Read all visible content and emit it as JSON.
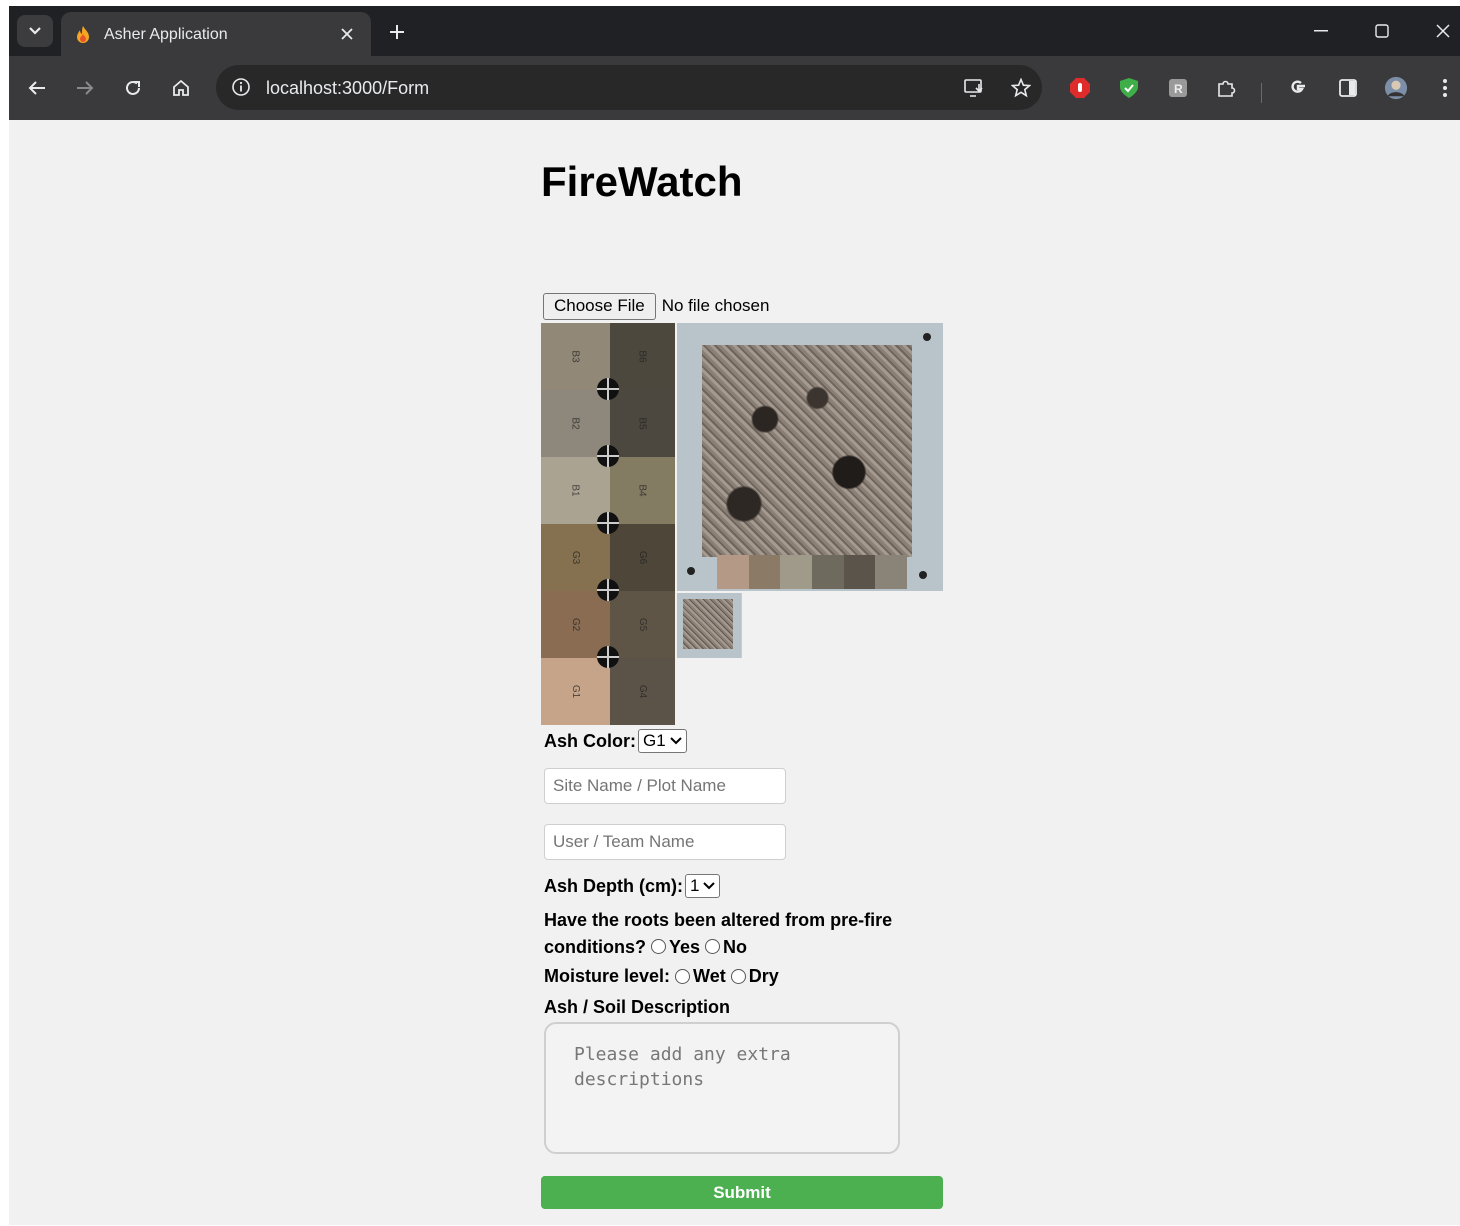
{
  "browser": {
    "tab_title": "Asher Application",
    "url": "localhost:3000/Form",
    "icons": {
      "tab_search": "chevron-down-icon",
      "favicon": "fire-icon",
      "close_tab": "close-icon",
      "new_tab": "plus-icon",
      "minimize": "minimize-icon",
      "maximize": "maximize-icon",
      "close_window": "close-icon",
      "back": "back-arrow-icon",
      "forward": "forward-arrow-icon",
      "reload": "reload-icon",
      "home": "home-icon",
      "site_info": "info-icon",
      "install": "install-app-icon",
      "bookmark": "star-icon",
      "extensions": "puzzle-icon",
      "google": "google-icon",
      "side_panel": "side-panel-icon",
      "profile": "avatar-icon",
      "menu": "kebab-menu-icon"
    }
  },
  "page": {
    "title": "FireWatch",
    "file_input": {
      "button_label": "Choose File",
      "status": "No file chosen"
    },
    "color_chart": [
      {
        "left": "B3",
        "left_color": "#918877",
        "right": "B6",
        "right_color": "#4c483e"
      },
      {
        "left": "B2",
        "left_color": "#8e877b",
        "right": "B5",
        "right_color": "#4c483f"
      },
      {
        "left": "B1",
        "left_color": "#aba392",
        "right": "B4",
        "right_color": "#847b63"
      },
      {
        "left": "G3",
        "left_color": "#85714f",
        "right": "G6",
        "right_color": "#4e4638"
      },
      {
        "left": "G2",
        "left_color": "#8a6c53",
        "right": "G5",
        "right_color": "#5f5546"
      },
      {
        "left": "G1",
        "left_color": "#c5a489",
        "right": "G4",
        "right_color": "#5b5348"
      }
    ],
    "ash_color": {
      "label": "Ash Color:",
      "selected": "G1"
    },
    "site_name": {
      "placeholder": "Site Name / Plot Name",
      "value": ""
    },
    "user_name": {
      "placeholder": "User / Team Name",
      "value": ""
    },
    "ash_depth": {
      "label": "Ash Depth (cm):",
      "selected": "1"
    },
    "roots_question": {
      "label": "Have the roots been altered from pre-fire conditions?",
      "option_yes": "Yes",
      "option_no": "No"
    },
    "moisture": {
      "label": "Moisture level:",
      "option_wet": "Wet",
      "option_dry": "Dry"
    },
    "description": {
      "label": "Ash / Soil Description",
      "placeholder": "Please add any extra descriptions"
    },
    "submit_label": "Submit",
    "colors": {
      "submit_bg": "#4caf50",
      "page_bg": "#f1f1f1",
      "chrome_bg": "#202124",
      "toolbar_bg": "#3a3a3c"
    }
  }
}
